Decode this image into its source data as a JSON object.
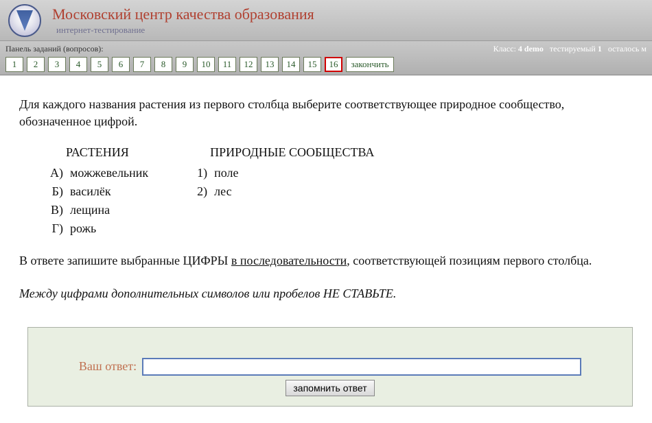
{
  "header": {
    "title": "Московский центр качества образования",
    "subtitle": "интернет-тестирование"
  },
  "panel": {
    "label": "Панель заданий (вопросов):",
    "status": {
      "class_label": "Класс:",
      "class_value": "4 demo",
      "user_label": "тестируемый",
      "user_value": "1",
      "remaining_label": "осталось м"
    },
    "tasks": [
      "1",
      "2",
      "3",
      "4",
      "5",
      "6",
      "7",
      "8",
      "9",
      "10",
      "11",
      "12",
      "13",
      "14",
      "15",
      "16"
    ],
    "current_index": 15,
    "finish": "закончить"
  },
  "question": {
    "intro": "Для каждого названия растения из первого столбца выберите соответствующее природное сообщество, обозначенное цифрой.",
    "left_header": "РАСТЕНИЯ",
    "right_header": "ПРИРОДНЫЕ СООБЩЕСТВА",
    "left_items": [
      {
        "label": "А)",
        "text": "можжевельник"
      },
      {
        "label": "Б)",
        "text": "василёк"
      },
      {
        "label": "В)",
        "text": "лещина"
      },
      {
        "label": "Г)",
        "text": "рожь"
      }
    ],
    "right_items": [
      {
        "label": "1)",
        "text": "поле"
      },
      {
        "label": "2)",
        "text": "лес"
      }
    ],
    "instruction_prefix": "В ответе запишите выбранные ЦИФРЫ ",
    "instruction_underline": "в последовательности",
    "instruction_suffix": ", соответствующей позициям первого столбца.",
    "note": "Между цифрами дополнительных символов или пробелов НЕ СТАВЬТЕ."
  },
  "answer": {
    "label": "Ваш ответ:",
    "value": "",
    "remember": "запомнить ответ"
  }
}
